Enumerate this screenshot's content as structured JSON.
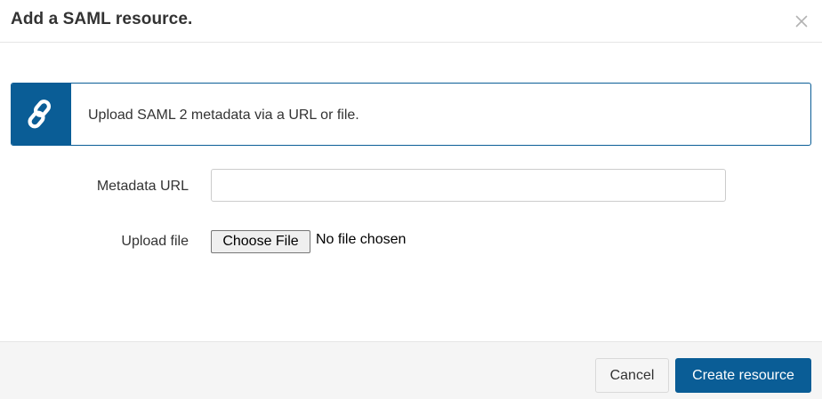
{
  "dialog": {
    "title": "Add a SAML resource.",
    "close_icon": "close-icon"
  },
  "info": {
    "icon": "link-icon",
    "text": "Upload SAML 2 metadata via a URL or file.",
    "accent_color": "#0a5d96"
  },
  "form": {
    "metadata_url": {
      "label": "Metadata URL",
      "value": "",
      "placeholder": ""
    },
    "upload_file": {
      "label": "Upload file",
      "button_label": "Choose File",
      "status": "No file chosen"
    }
  },
  "footer": {
    "cancel_label": "Cancel",
    "create_label": "Create resource",
    "primary_color": "#0a5d96"
  }
}
